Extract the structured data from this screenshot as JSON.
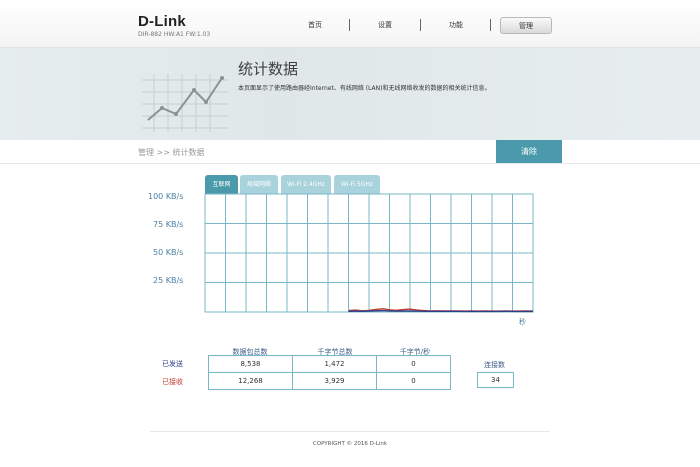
{
  "header": {
    "logo": "D-Link",
    "model": "DIR-882 HW:A1 FW:1.03",
    "nav": [
      {
        "label": "首页"
      },
      {
        "label": "设置"
      },
      {
        "label": "功能"
      },
      {
        "label": "管理"
      }
    ]
  },
  "banner": {
    "title": "统计数据",
    "description": "本页面显示了使用路由器经Internet、有线网络 (LAN)和无线网络收发的数据的相关统计信息。"
  },
  "breadcrumb": "管理 >> 统计数据",
  "clear_button": "清除",
  "tabs": [
    {
      "label": "互联网",
      "active": true
    },
    {
      "label": "局域网络",
      "active": false
    },
    {
      "label": "Wi-Fi 2.4GHz",
      "active": false
    },
    {
      "label": "Wi-Fi 5GHz",
      "active": false
    }
  ],
  "chart_data": {
    "type": "line",
    "y_tick_labels": [
      "100 KB/s",
      "75 KB/s",
      "50 KB/s",
      "25 KB/s"
    ],
    "ylim": [
      0,
      100
    ],
    "xlabel": "秒",
    "grid": true,
    "x": [
      0,
      1,
      2,
      3,
      4,
      5,
      6,
      7,
      8,
      9,
      10,
      11,
      12,
      13,
      14,
      15,
      16,
      17,
      18,
      19,
      20,
      21,
      22,
      23,
      24,
      25,
      26,
      27,
      28,
      29,
      30,
      31,
      32,
      33,
      34,
      35,
      36,
      37,
      38,
      39,
      40,
      41,
      42,
      43,
      44,
      45,
      46,
      47,
      48
    ],
    "series": [
      {
        "color": "#c0392b",
        "values": [
          0,
          0,
          0,
          0,
          0,
          0,
          0,
          0,
          0,
          0,
          0,
          0,
          0,
          0,
          0,
          0,
          0,
          0,
          0,
          0,
          0,
          0.8,
          1.2,
          0.6,
          0.9,
          1.8,
          2.4,
          1.4,
          1.0,
          1.6,
          2.0,
          1.2,
          0.8,
          0.5,
          0.6,
          0.4,
          0.5,
          0.4,
          0.3,
          0.4,
          0.3,
          0.4,
          0.3,
          0.3,
          0.4,
          0.3,
          0.3,
          0.4,
          0.3
        ]
      },
      {
        "color": "#2c3e8c",
        "values": [
          0,
          0,
          0,
          0,
          0,
          0,
          0,
          0,
          0,
          0,
          0,
          0,
          0,
          0,
          0,
          0,
          0,
          0,
          0,
          0,
          0,
          0.2,
          0.3,
          0.2,
          0.4,
          0.6,
          0.8,
          0.5,
          0.3,
          0.4,
          0.5,
          0.3,
          0.2,
          0.2,
          0.2,
          0.2,
          0.2,
          0.2,
          0.1,
          0.2,
          0.1,
          0.2,
          0.1,
          0.1,
          0.2,
          0.1,
          0.1,
          0.2,
          0.1
        ]
      }
    ]
  },
  "stats": {
    "headers": [
      "数据包总数",
      "千字节总数",
      "千字节/秒"
    ],
    "sent_label": "已发送",
    "received_label": "已接收",
    "sent": [
      "8,538",
      "1,472",
      "0"
    ],
    "received": [
      "12,268",
      "3,929",
      "0"
    ],
    "connections_label": "连接数",
    "connections": "34"
  },
  "copyright": "COPYRIGHT © 2016 D-Link",
  "colors": {
    "accent": "#4a9aab",
    "tab_inactive": "#a8d2dc",
    "grid": "#79b7c6",
    "sent": "#2c3e8c",
    "received": "#c0392b"
  }
}
